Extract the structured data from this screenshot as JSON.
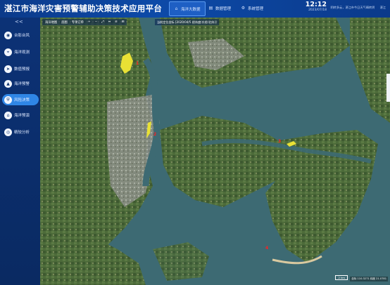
{
  "header": {
    "title": "湛江市海洋灾害预警辅助决策技术应用平台",
    "nav": [
      {
        "label": "海洋大数据",
        "icon": "home-icon",
        "active": true
      },
      {
        "label": "数据管理",
        "icon": "database-icon",
        "active": false
      },
      {
        "label": "系统管理",
        "icon": "settings-icon",
        "active": false
      }
    ],
    "time": "12:12",
    "date": "2023/07/18",
    "weather": "阴转多云，湛江市今日天气晴转阴",
    "user": "湛江"
  },
  "sidebar": {
    "collapse": "<<",
    "items": [
      {
        "label": "台影台风",
        "icon": "typhoon-icon",
        "active": false
      },
      {
        "label": "海洋观测",
        "icon": "telescope-icon",
        "active": false
      },
      {
        "label": "数值预报",
        "icon": "send-icon",
        "active": false
      },
      {
        "label": "海洋预警",
        "icon": "warning-icon",
        "active": false
      },
      {
        "label": "风险决策",
        "icon": "shield-icon",
        "active": true
      },
      {
        "label": "海洋预演",
        "icon": "house-icon",
        "active": false
      },
      {
        "label": "精较分析",
        "icon": "analysis-icon",
        "active": false
      }
    ]
  },
  "toolbar": {
    "items": [
      "海洋地图",
      "底图",
      "专项订单",
      "+",
      "−",
      "⤢",
      "⇔",
      "≡",
      "⊞"
    ],
    "coordinate": "当前定位坐标 [2020/04/5 经纬度(东经/北纬)]"
  },
  "map": {
    "markers": [
      "1",
      "2",
      "3",
      "4"
    ],
    "scale_label": "2 km",
    "status": "坐标 110.3271  纬度 21.0781"
  }
}
